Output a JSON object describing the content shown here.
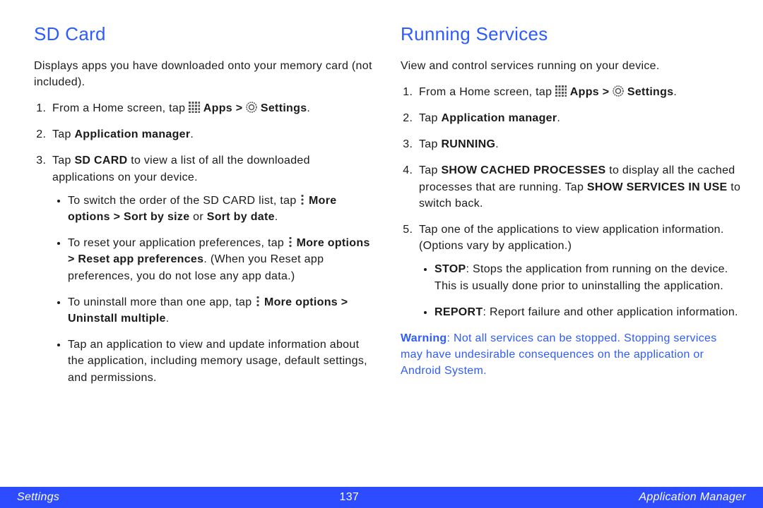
{
  "left": {
    "heading": "SD Card",
    "intro": "Displays apps you have downloaded onto your memory card (not included).",
    "step1_a": "From a Home screen, tap ",
    "apps_b": "Apps > ",
    "settings_b": "Settings",
    "step2_a": "Tap ",
    "step2_b": "Application manager",
    "step3_a": "Tap ",
    "step3_b": "SD CARD",
    "step3_c": " to view a list of all the downloaded applications on your device.",
    "b1_a": "To switch the order of the SD CARD list, tap ",
    "b1_b": "More options > Sort by size",
    "b1_c": " or ",
    "b1_d": "Sort by date",
    "b2_a": "To reset your application preferences, tap ",
    "b2_b": "More options > Reset app preferences",
    "b2_c": ". (When you Reset app preferences, you do not lose any app data.)",
    "b3_a": "To uninstall more than one app, tap ",
    "b3_b": "More options > Uninstall multiple",
    "b4": "Tap an application to view and update information about the application, including memory usage, default settings, and permissions."
  },
  "right": {
    "heading": "Running Services",
    "intro": "View and control services running on your device.",
    "step3_a": "Tap ",
    "step3_b": "RUNNING",
    "step4_a": "Tap ",
    "step4_b": "SHOW CACHED PROCESSES",
    "step4_c": " to display all the cached processes that are running. Tap ",
    "step4_d": "SHOW SERVICES IN USE",
    "step4_e": " to switch back.",
    "step5": "Tap one of the applications to view application information. (Options vary by application.)",
    "b1_a": "STOP",
    "b1_b": ": Stops the application from running on the device. This is usually done prior to uninstalling the application.",
    "b2_a": "REPORT",
    "b2_b": ": Report failure and other application information.",
    "warn_a": "Warning",
    "warn_b": ": Not all services can be stopped. Stopping services may have undesirable consequences on the application or Android System."
  },
  "footer": {
    "left": "Settings",
    "center": "137",
    "right": "Application Manager"
  },
  "period": "."
}
